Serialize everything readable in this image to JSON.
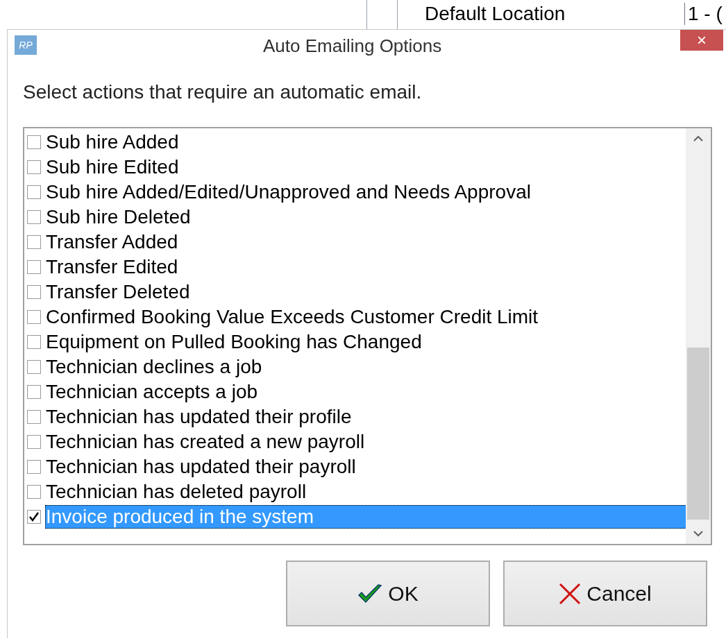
{
  "background_window": {
    "field_label": "Default Location",
    "field_value": "1 - ("
  },
  "window": {
    "logo": "RP",
    "title": "Auto Emailing Options",
    "close": "×"
  },
  "instruction": "Select actions that require an automatic email.",
  "actions": [
    {
      "label": "Sub hire Added",
      "checked": false,
      "selected": false
    },
    {
      "label": "Sub hire Edited",
      "checked": false,
      "selected": false
    },
    {
      "label": "Sub hire Added/Edited/Unapproved and Needs Approval",
      "checked": false,
      "selected": false
    },
    {
      "label": "Sub hire Deleted",
      "checked": false,
      "selected": false
    },
    {
      "label": "Transfer Added",
      "checked": false,
      "selected": false
    },
    {
      "label": "Transfer Edited",
      "checked": false,
      "selected": false
    },
    {
      "label": "Transfer Deleted",
      "checked": false,
      "selected": false
    },
    {
      "label": "Confirmed Booking Value Exceeds Customer Credit Limit",
      "checked": false,
      "selected": false
    },
    {
      "label": "Equipment on Pulled Booking has Changed",
      "checked": false,
      "selected": false
    },
    {
      "label": "Technician declines a job",
      "checked": false,
      "selected": false
    },
    {
      "label": "Technician accepts a job",
      "checked": false,
      "selected": false
    },
    {
      "label": "Technician has updated their profile",
      "checked": false,
      "selected": false
    },
    {
      "label": "Technician has created a new payroll",
      "checked": false,
      "selected": false
    },
    {
      "label": "Technician has updated their payroll",
      "checked": false,
      "selected": false
    },
    {
      "label": "Technician has deleted payroll",
      "checked": false,
      "selected": false
    },
    {
      "label": "Invoice produced in the system",
      "checked": true,
      "selected": true
    }
  ],
  "buttons": [
    {
      "label": "OK",
      "kind": "ok"
    },
    {
      "label": "Cancel",
      "kind": "cancel"
    }
  ]
}
